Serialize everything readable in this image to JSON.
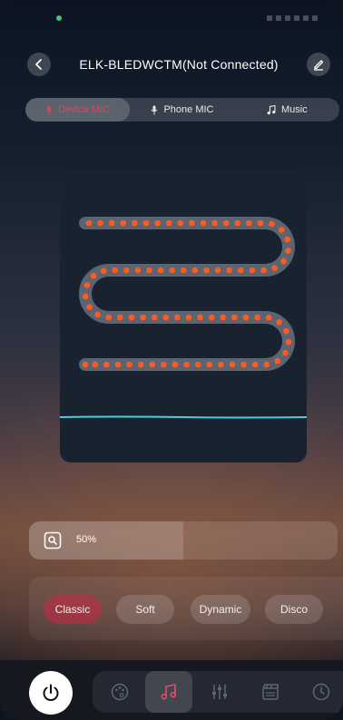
{
  "header": {
    "title": "ELK-BLEDWCTM(Not Connected)",
    "back_icon": "chevron-left-icon",
    "edit_icon": "edit-pencil-icon"
  },
  "mic_tabs": [
    {
      "label": "Device MIC",
      "icon": "mic-icon",
      "active": true
    },
    {
      "label": "Phone MIC",
      "icon": "mic-icon",
      "active": false
    },
    {
      "label": "Music",
      "icon": "music-note-icon",
      "active": false
    }
  ],
  "brightness": {
    "value": "50%",
    "level": 0.5,
    "icon": "brightness-icon"
  },
  "modes": [
    {
      "label": "Classic",
      "active": true
    },
    {
      "label": "Soft",
      "active": false
    },
    {
      "label": "Dynamic",
      "active": false
    },
    {
      "label": "Disco",
      "active": false
    }
  ],
  "bottom_nav": {
    "power_icon": "power-icon",
    "items": [
      {
        "icon": "palette-icon",
        "active": false
      },
      {
        "icon": "music-icon",
        "active": true
      },
      {
        "icon": "equalizer-icon",
        "active": false
      },
      {
        "icon": "scene-icon",
        "active": false
      },
      {
        "icon": "clock-icon",
        "active": false
      }
    ]
  },
  "colors": {
    "accent": "#d84a5a",
    "led": "#ff5a1f",
    "waveform": "#3fd0e6",
    "card": "#18232f"
  }
}
